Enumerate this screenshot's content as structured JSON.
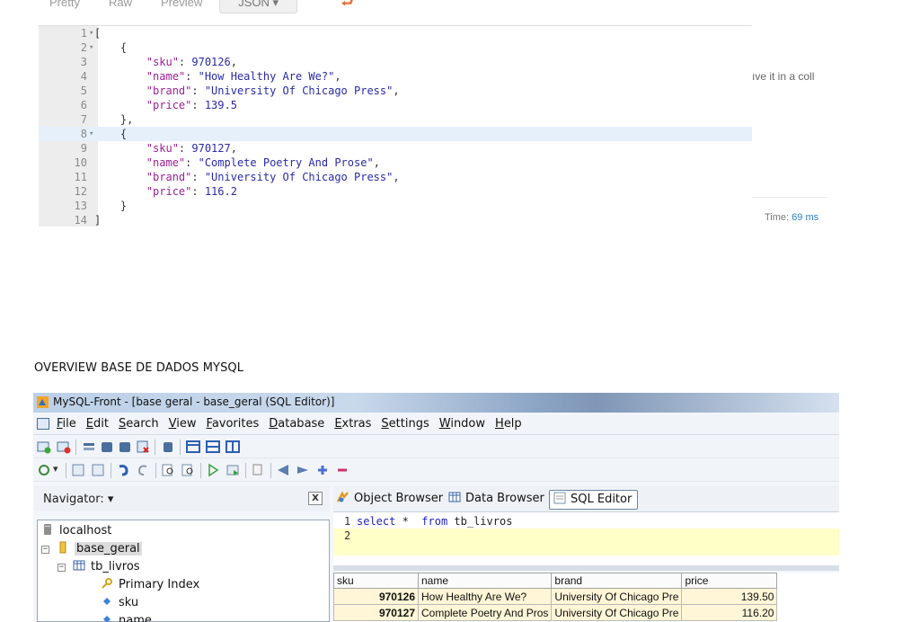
{
  "postman": {
    "tabs": [
      "Pretty",
      "Raw",
      "Preview",
      "JSON ▾"
    ],
    "wrap_icon": "wrap-lines-icon",
    "code_lines": [
      {
        "n": "1",
        "fold": "▾",
        "text": "["
      },
      {
        "n": "2",
        "fold": "▾",
        "text": "    {"
      },
      {
        "n": "3",
        "fold": "",
        "key": "\"sku\"",
        "val": "970126",
        "tail": ","
      },
      {
        "n": "4",
        "fold": "",
        "key": "\"name\"",
        "val": "\"How Healthy Are We?\"",
        "tail": ","
      },
      {
        "n": "5",
        "fold": "",
        "key": "\"brand\"",
        "val": "\"University Of Chicago Press\"",
        "tail": ","
      },
      {
        "n": "6",
        "fold": "",
        "key": "\"price\"",
        "val": "139.5",
        "tail": ""
      },
      {
        "n": "7",
        "fold": "",
        "text": "    },"
      },
      {
        "n": "8",
        "fold": "▾",
        "text": "    {"
      },
      {
        "n": "9",
        "fold": "",
        "key": "\"sku\"",
        "val": "970127",
        "tail": ","
      },
      {
        "n": "10",
        "fold": "",
        "key": "\"name\"",
        "val": "\"Complete Poetry And Prose\"",
        "tail": ","
      },
      {
        "n": "11",
        "fold": "",
        "key": "\"brand\"",
        "val": "\"University Of Chicago Press\"",
        "tail": ","
      },
      {
        "n": "12",
        "fold": "",
        "key": "\"price\"",
        "val": "116.2",
        "tail": ""
      },
      {
        "n": "13",
        "fold": "",
        "text": "    }"
      },
      {
        "n": "14",
        "fold": "",
        "text": "]"
      }
    ],
    "side_text": "ıve it in a coll",
    "time_label": "Time:",
    "time_value": "69 ms"
  },
  "heading": "OVERVIEW BASE DE DADOS MYSQL",
  "mysql": {
    "title": "MySQL-Front - [base geral - base_geral  (SQL Editor)]",
    "menu": [
      "File",
      "Edit",
      "Search",
      "View",
      "Favorites",
      "Database",
      "Extras",
      "Settings",
      "Window",
      "Help"
    ],
    "navigator_label": "Navigator:  ▾",
    "close_label": "X",
    "tree": {
      "host": "localhost",
      "database": "base_geral",
      "table": "tb_livros",
      "index": "Primary Index",
      "fields": [
        "sku",
        "name"
      ]
    },
    "tabs": [
      "Object Browser",
      "Data Browser",
      "SQL Editor"
    ],
    "sql_lines": [
      {
        "n": "1",
        "parts": [
          {
            "t": "select",
            "kw": true
          },
          {
            "t": " *  ",
            "kw": false
          },
          {
            "t": "from",
            "kw": true
          },
          {
            "t": " tb_livros",
            "kw": false
          }
        ]
      },
      {
        "n": "2",
        "parts": []
      }
    ],
    "grid": {
      "headers": [
        "sku",
        "name",
        "brand",
        "price"
      ],
      "rows": [
        [
          "970126",
          "How Healthy Are We?",
          "University Of Chicago Pre",
          "139.50"
        ],
        [
          "970127",
          "Complete Poetry And Pros",
          "University Of Chicago Pre",
          "116.20"
        ]
      ]
    }
  }
}
